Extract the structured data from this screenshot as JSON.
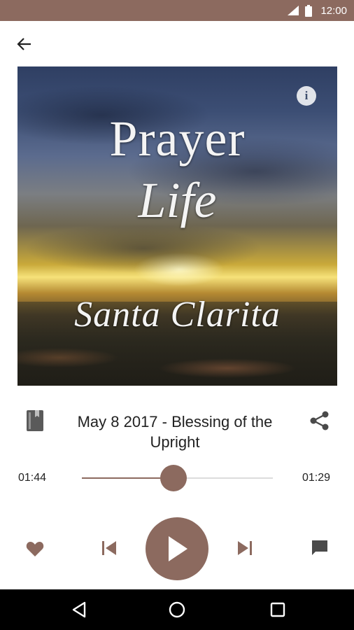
{
  "status_bar": {
    "time": "12:00",
    "icons": [
      "signal-icon",
      "battery-icon"
    ],
    "background": "#8c6a5f"
  },
  "app_bar": {
    "back_icon": "arrow-left-icon"
  },
  "cover": {
    "line1": "Prayer",
    "line2": "Life",
    "line3": "Santa Clarita",
    "info_icon": "info-icon",
    "info_label": "i"
  },
  "track": {
    "title": "May 8 2017 - Blessing of the Upright",
    "book_icon": "book-icon",
    "share_icon": "share-icon"
  },
  "player": {
    "elapsed": "01:44",
    "remaining": "01:29",
    "progress": 0.48,
    "accent": "#8c6a5f",
    "controls": [
      "heart-icon",
      "skip-previous-icon",
      "play-icon",
      "skip-next-icon",
      "comment-icon"
    ]
  },
  "nav_bar": {
    "buttons": [
      "back-triangle-icon",
      "home-circle-icon",
      "recents-square-icon"
    ]
  }
}
